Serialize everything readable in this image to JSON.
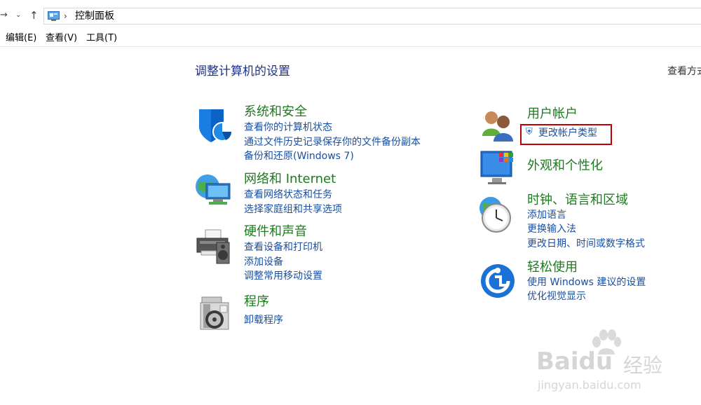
{
  "address": {
    "path": "控制面板"
  },
  "menu": [
    "编辑(E)",
    "查看(V)",
    "工具(T)"
  ],
  "page": {
    "title": "调整计算机的设置",
    "view_by": "查看方式"
  },
  "categories": {
    "system": {
      "title": "系统和安全",
      "links": [
        "查看你的计算机状态",
        "通过文件历史记录保存你的文件备份副本",
        "备份和还原(Windows 7)"
      ]
    },
    "network": {
      "title": "网络和 Internet",
      "links": [
        "查看网络状态和任务",
        "选择家庭组和共享选项"
      ]
    },
    "hardware": {
      "title": "硬件和声音",
      "links": [
        "查看设备和打印机",
        "添加设备",
        "调整常用移动设置"
      ]
    },
    "programs": {
      "title": "程序",
      "links": [
        "卸载程序"
      ]
    },
    "user": {
      "title": "用户帐户",
      "links": [
        "更改帐户类型"
      ]
    },
    "appearance": {
      "title": "外观和个性化",
      "links": []
    },
    "clock": {
      "title": "时钟、语言和区域",
      "links": [
        "添加语言",
        "更换输入法",
        "更改日期、时间或数字格式"
      ]
    },
    "ease": {
      "title": "轻松使用",
      "links": [
        "使用 Windows 建议的设置",
        "优化视觉显示"
      ]
    }
  },
  "watermark": {
    "brand": "Baidu",
    "suffix": "经验",
    "url": "jingyan.baidu.com"
  },
  "colors": {
    "category_title": "#1e7a1e",
    "link": "#1a4fa0",
    "page_title": "#1e3287",
    "highlight": "#c00000"
  }
}
